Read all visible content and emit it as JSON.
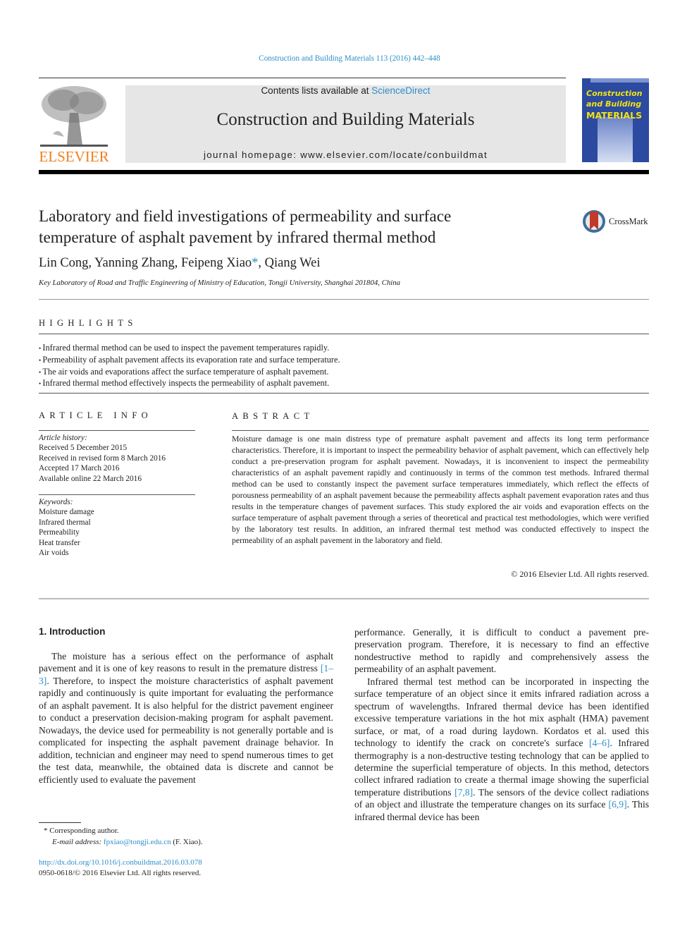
{
  "header": {
    "journal_reference": "Construction and Building Materials 113 (2016) 442–448",
    "contents_prefix": "Contents lists available at ",
    "contents_link": "ScienceDirect",
    "journal_title": "Construction and Building Materials",
    "homepage": "journal homepage: www.elsevier.com/locate/conbuildmat",
    "publisher_logo_text": "ELSEVIER",
    "cover": {
      "line1": "Construction",
      "line2": "and Building",
      "line3": "MATERIALS"
    },
    "colors": {
      "link": "#2c8fc9",
      "elsevier_orange": "#f07f1f",
      "cover_blue": "#2c4aa0",
      "cover_yellow": "#f2e312"
    }
  },
  "article": {
    "title_line1": "Laboratory and field investigations of permeability and surface",
    "title_line2": "temperature of asphalt pavement by infrared thermal method",
    "crossmark_label": "CrossMark",
    "authors_before": "Lin Cong, Yanning Zhang, Feipeng Xiao",
    "authors_star": "*",
    "authors_after": ", Qiang Wei",
    "affiliation": "Key Laboratory of Road and Traffic Engineering of Ministry of Education, Tongji University, Shanghai 201804, China"
  },
  "highlights": {
    "heading": "HIGHLIGHTS",
    "items": [
      "Infrared thermal method can be used to inspect the pavement temperatures rapidly.",
      "Permeability of asphalt pavement affects its evaporation rate and surface temperature.",
      "The air voids and evaporations affect the surface temperature of asphalt pavement.",
      "Infrared thermal method effectively inspects the permeability of asphalt pavement."
    ]
  },
  "article_info": {
    "heading": "ARTICLE INFO",
    "history_label": "Article history:",
    "history": [
      "Received 5 December 2015",
      "Received in revised form 8 March 2016",
      "Accepted 17 March 2016",
      "Available online 22 March 2016"
    ],
    "keywords_label": "Keywords:",
    "keywords": [
      "Moisture damage",
      "Infrared thermal",
      "Permeability",
      "Heat transfer",
      "Air voids"
    ]
  },
  "abstract": {
    "heading": "ABSTRACT",
    "text": "Moisture damage is one main distress type of premature asphalt pavement and affects its long term per­formance characteristics. Therefore, it is important to inspect the permeability behavior of asphalt pave­ment, which can effectively help conduct a pre-preservation program for asphalt pavement. Nowadays, it is inconvenient to inspect the permeability characteristics of an asphalt pavement rapidly and continu­ously in terms of the common test methods. Infrared thermal method can be used to constantly inspect the pavement surface temperatures immediately, which reflect the effects of porousness permeability of an asphalt pavement because the permeability affects asphalt pavement evaporation rates and thus results in the temperature changes of pavement surfaces. This study explored the air voids and evapora­tion effects on the surface temperature of asphalt pavement through a series of theoretical and practical test methodologies, which were verified by the laboratory test results. In addition, an infrared thermal test method was conducted effectively to inspect the permeability of an asphalt pavement in the labora­tory and field.",
    "copyright": "© 2016 Elsevier Ltd. All rights reserved."
  },
  "intro": {
    "heading": "1. Introduction",
    "left_p1_a": "The moisture has a serious effect on the performance of asphalt pavement and it is one of key reasons to result in the premature distress ",
    "left_p1_ref1": "[1–3]",
    "left_p1_b": ". Therefore, to inspect the moisture characteristics of asphalt pavement rapidly and continuously is quite important for evaluating the performance of an asphalt pavement. It is also helpful for the district pavement engineer to conduct a preserva­tion decision-making program for asphalt pavement. Nowadays, the device used for permeability is not generally portable and is complicated for inspecting the asphalt pavement drainage behav­ior. In addition, technician and engineer may need to spend numer­ous times to get the test data, meanwhile, the obtained data is discrete and cannot be efficiently used to evaluate the pavement",
    "right_p1": "performance. Generally, it is difficult to conduct a pavement pre-preservation program. Therefore, it is necessary to find an effective nondestructive method to rapidly and comprehensively assess the permeability of an asphalt pavement.",
    "right_p2_a": "Infrared thermal test method can be incorporated in inspecting the surface temperature of an object since it emits infrared radia­tion across a spectrum of wavelengths. Infrared thermal device has been identified excessive temperature variations in the hot mix asphalt (HMA) pavement surface, or mat, of a road during lay­down. Kordatos et al. used this technology to identify the crack on concrete's surface ",
    "right_p2_ref1": "[4–6]",
    "right_p2_b": ". Infrared thermography is a non-destructive testing technology that can be applied to determine the superficial temperature of objects. In this method, detectors collect infrared radiation to create a thermal image showing the superficial temperature distributions ",
    "right_p2_ref2": "[7,8]",
    "right_p2_c": ". The sensors of the device collect radiations of an object and illustrate the temperature changes on its surface ",
    "right_p2_ref3": "[6,9]",
    "right_p2_d": ". This infrared thermal device has been"
  },
  "footnote": {
    "star_line": "*  Corresponding author.",
    "email_label": "E-mail address: ",
    "email": "fpxiao@tongji.edu.cn",
    "email_suffix": " (F. Xiao).",
    "doi": "http://dx.doi.org/10.1016/j.conbuildmat.2016.03.078",
    "issn_line": "0950-0618/© 2016 Elsevier Ltd. All rights reserved."
  }
}
